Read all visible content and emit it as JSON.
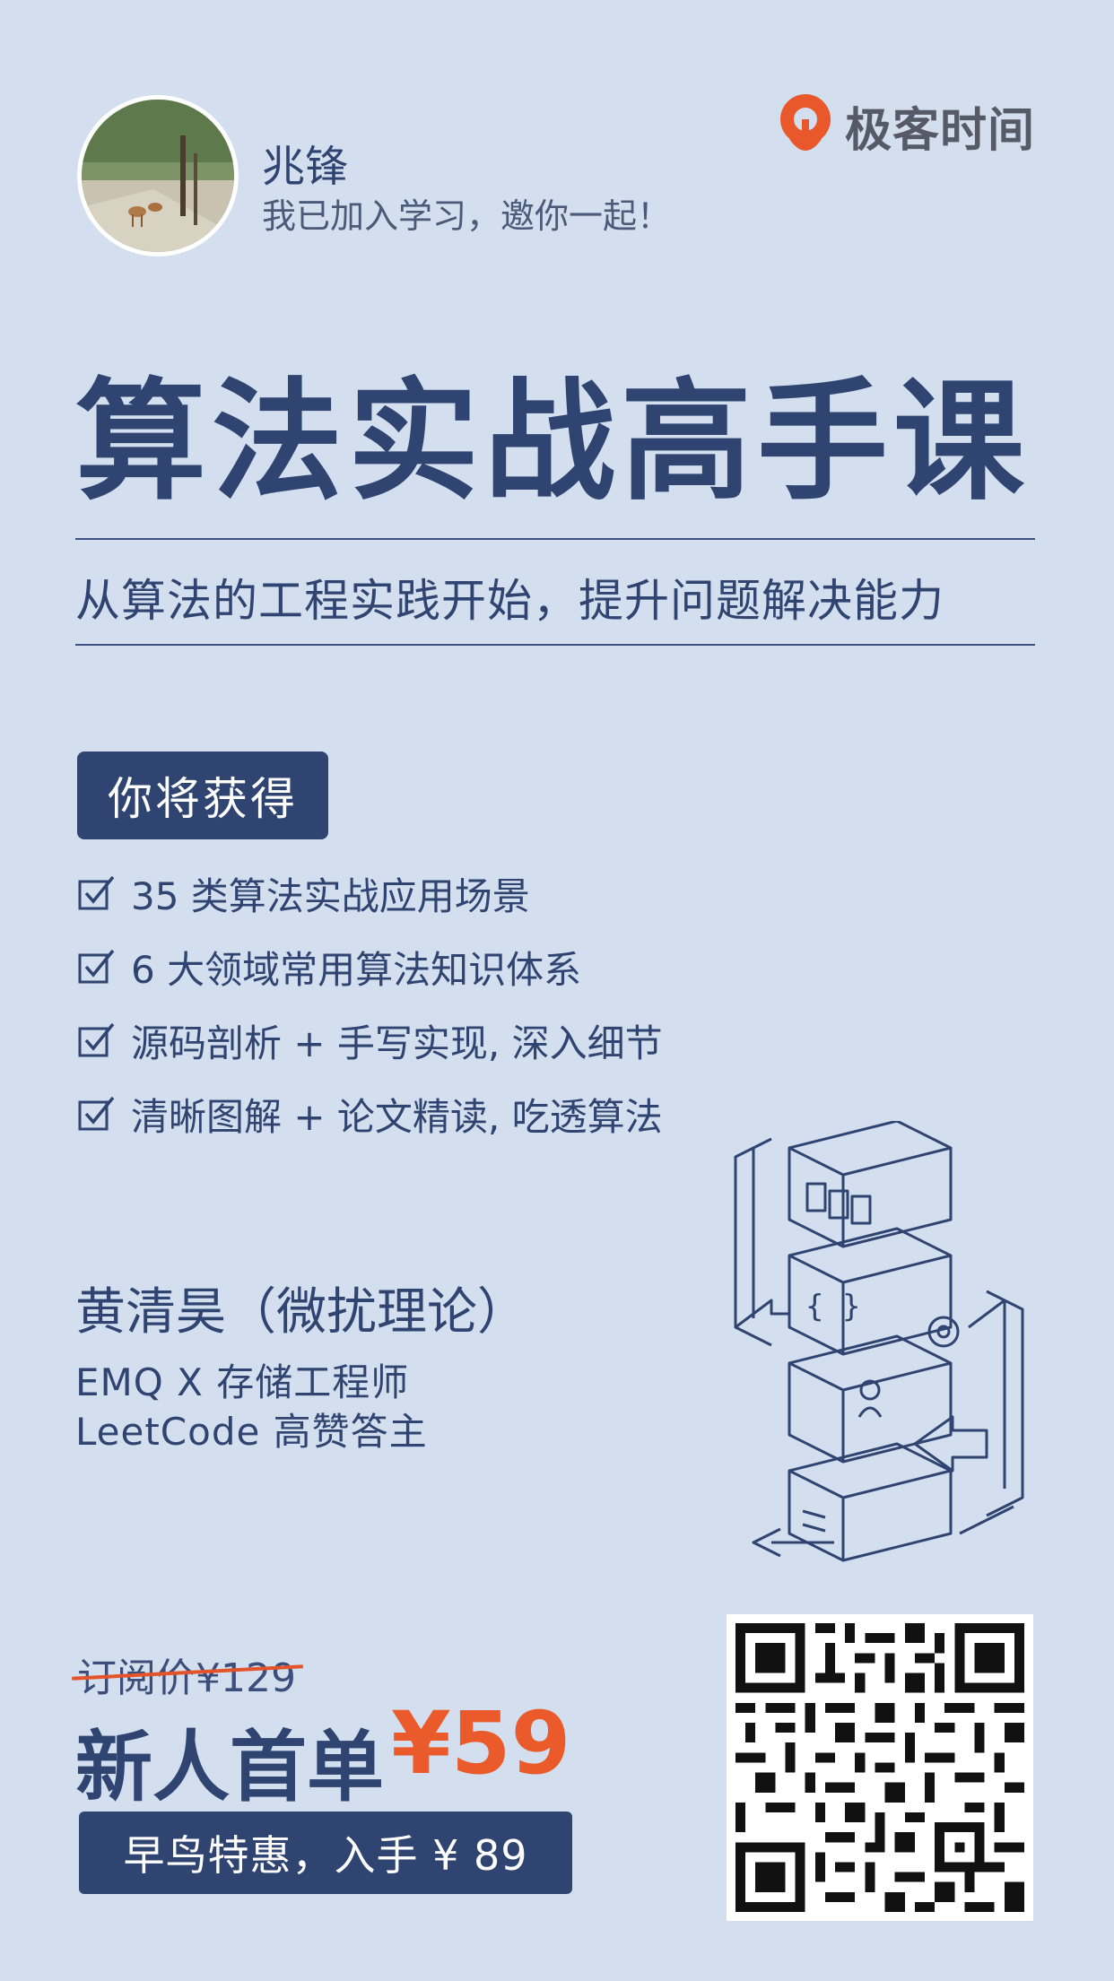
{
  "header": {
    "user_name": "兆锋",
    "invite_text": "我已加入学习，邀你一起！",
    "brand_name": "极客时间",
    "brand_color": "#e9582a"
  },
  "course": {
    "title": "算法实战高手课",
    "subtitle": "从算法的工程实践开始，提升问题解决能力"
  },
  "benefits": {
    "heading": "你将获得",
    "items": [
      {
        "label": "35 类算法实战应用场景"
      },
      {
        "label": "6 大领域常用算法知识体系"
      },
      {
        "label": "源码剖析 + 手写实现, 深入细节"
      },
      {
        "label": "清晰图解 + 论文精读, 吃透算法"
      }
    ]
  },
  "author": {
    "name": "黄清昊（微扰理论）",
    "roles": [
      "EMQ X 存储工程师",
      "LeetCode 高赞答主"
    ]
  },
  "pricing": {
    "original_price": "订阅价¥129",
    "new_user_label": "新人首单",
    "new_user_price": "¥59",
    "early_bird": "早鸟特惠，入手 ¥ 89",
    "price_color": "#ea5a2a"
  },
  "colors": {
    "background": "#d3dfee",
    "primary": "#2f4470"
  }
}
